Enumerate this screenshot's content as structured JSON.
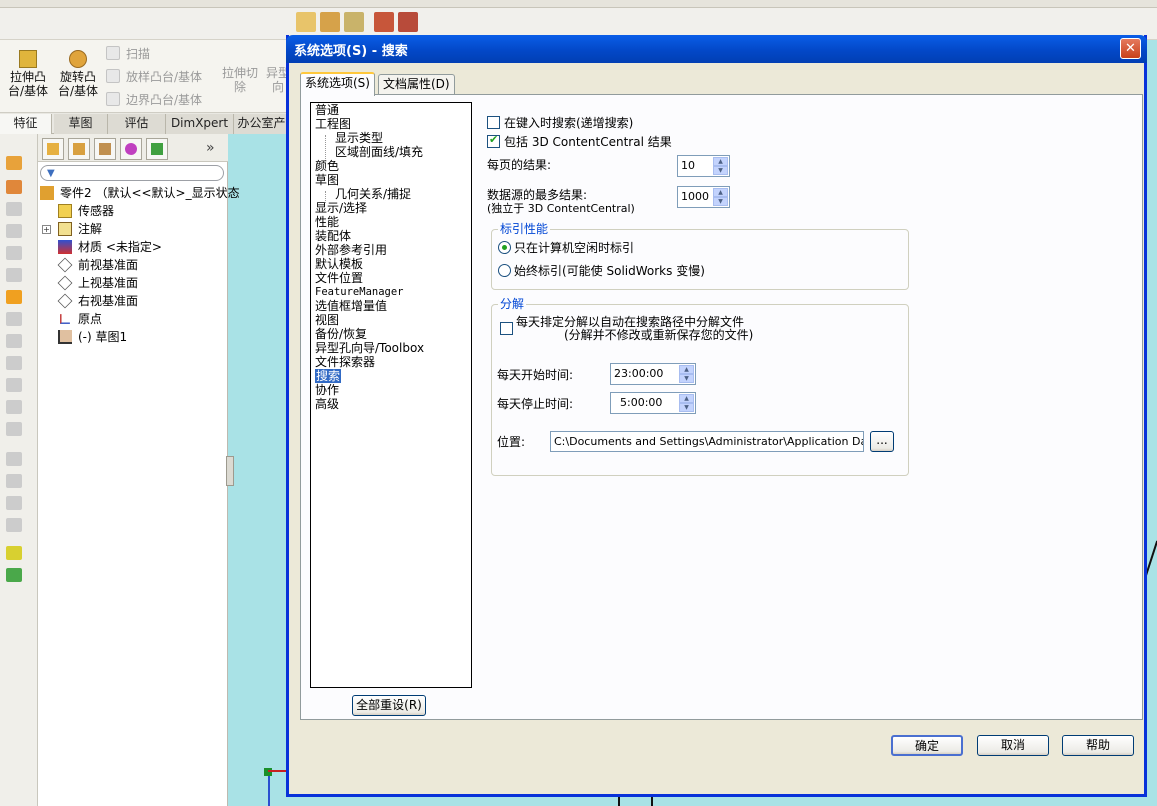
{
  "ribbon": {
    "extrude_boss_line1": "拉伸凸",
    "extrude_boss_line2": "台/基体",
    "revolve_boss_line1": "旋转凸",
    "revolve_boss_line2": "台/基体",
    "sweep": "扫描",
    "loft_boss": "放样凸台/基体",
    "boundary_boss": "边界凸台/基体",
    "extrude_cut_line1": "拉伸切",
    "extrude_cut_line2": "除",
    "partial_line1": "异型",
    "partial_line2": "向"
  },
  "command_tabs": [
    "特征",
    "草图",
    "评估",
    "DimXpert",
    "办公室产"
  ],
  "feature_tree": {
    "part": "零件2 （默认<<默认>_显示状态",
    "items": [
      "传感器",
      "注解",
      "材质 <未指定>",
      "前视基准面",
      "上视基准面",
      "右视基准面",
      "原点",
      "(-) 草图1"
    ],
    "more": "»"
  },
  "dialog": {
    "title": "系统选项(S) - 搜索",
    "close": "✕",
    "tabs": [
      "系统选项(S)",
      "文档属性(D)"
    ],
    "categories": [
      "普通",
      "工程图",
      "显示类型",
      "区域剖面线/填充",
      "颜色",
      "草图",
      "几何关系/捕捉",
      "显示/选择",
      "性能",
      "装配体",
      "外部参考引用",
      "默认模板",
      "文件位置",
      "FeatureManager",
      "选值框增量值",
      "视图",
      "备份/恢复",
      "异型孔向导/Toolbox",
      "文件探索器",
      "搜索",
      "协作",
      "高级"
    ],
    "reset_all": "全部重设(R)",
    "search_as_you_type": "在键入时搜索(递增搜索)",
    "include_contentcentral": "包括 3D ContentCentral 结果",
    "results_per_page_label": "每页的结果:",
    "results_per_page": "10",
    "max_results_label_1": "数据源的最多结果:",
    "max_results_label_2": "(独立于 3D ContentCentral)",
    "max_results": "1000",
    "indexing_group": "标引性能",
    "index_idle": "只在计算机空闲时标引",
    "index_always": "始终标引(可能使 SolidWorks 变慢)",
    "split_group": "分解",
    "split_daily_1": "每天排定分解以自动在搜索路径中分解文件",
    "split_daily_2": "(分解并不修改或重新保存您的文件)",
    "start_time_label": "每天开始时间:",
    "start_time": "23:00:00",
    "stop_time_label": "每天停止时间:",
    "stop_time": "5:00:00",
    "location_label": "位置:",
    "location": "C:\\Documents and Settings\\Administrator\\Application Data\\Solid'",
    "browse": "...",
    "ok": "确定",
    "cancel": "取消",
    "help": "帮助"
  },
  "state": {
    "active_category": "搜索",
    "search_as_you_type_checked": false,
    "include_contentcentral_checked": true,
    "index_mode": "idle",
    "split_daily_checked": false
  }
}
